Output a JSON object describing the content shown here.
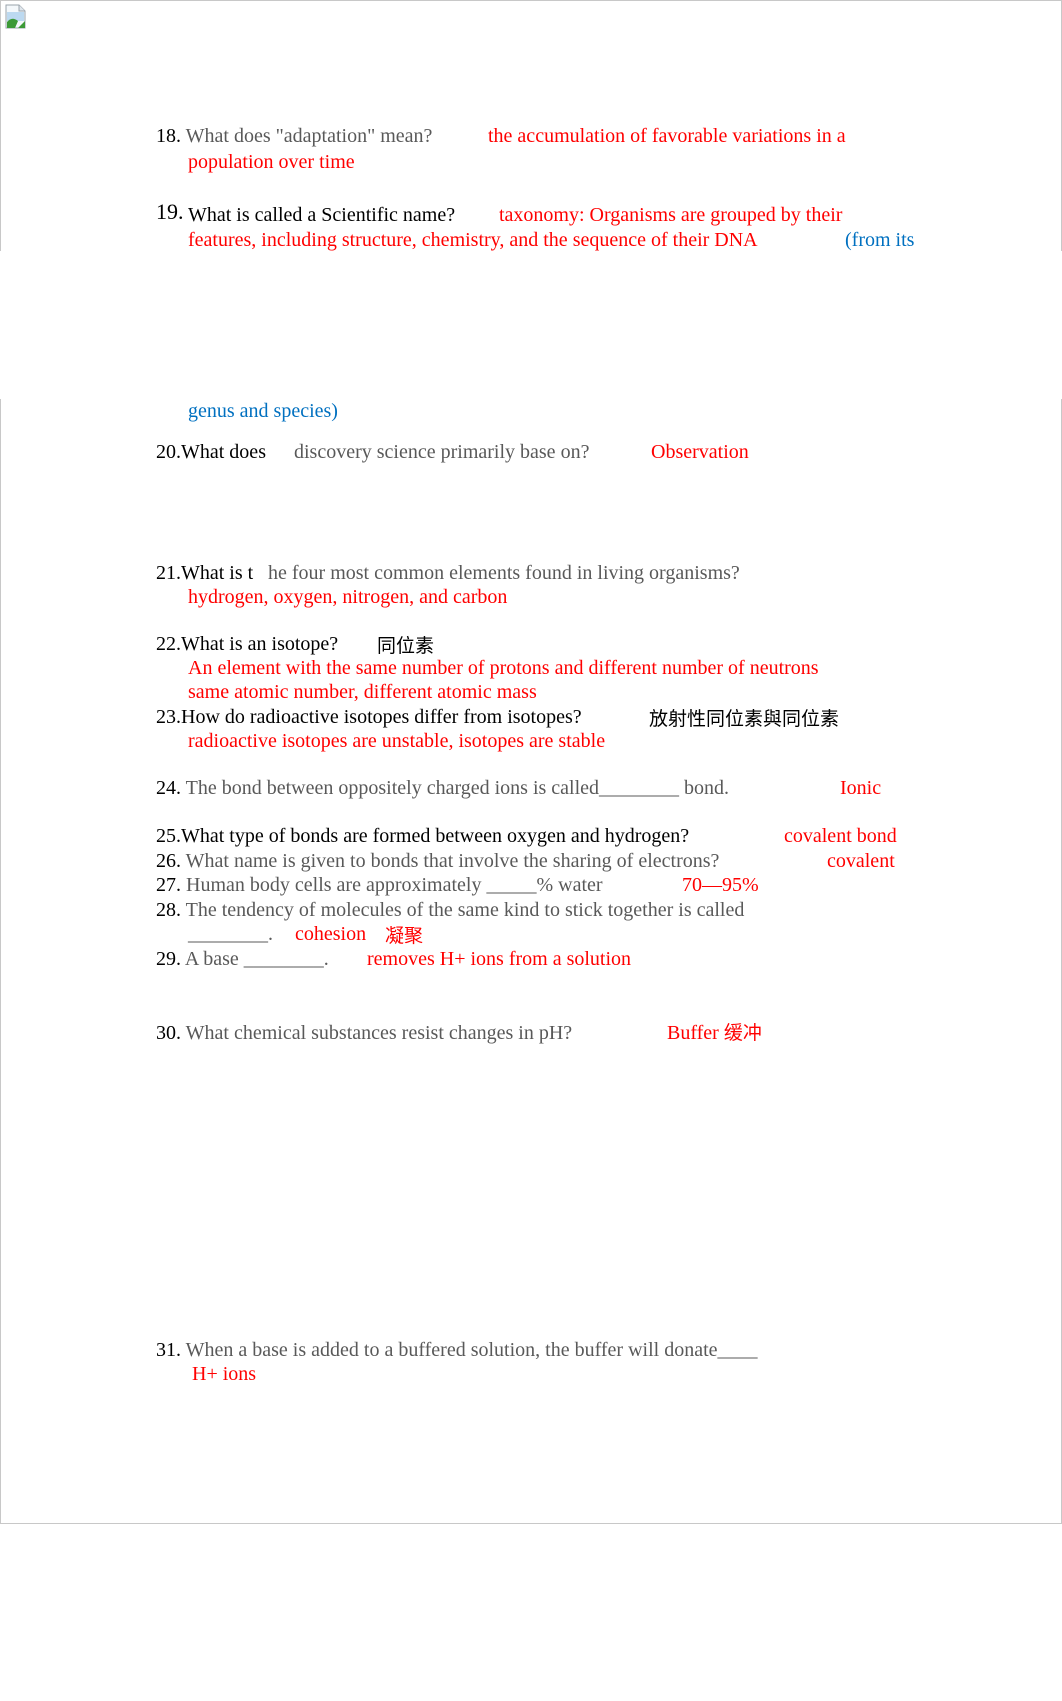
{
  "document": {
    "broken_image_icon": "broken-image-icon",
    "questions": [
      {
        "number": "18.",
        "question": "What does \"adaptation\" mean?",
        "answer_line1": "the accumulation of favorable variations in a",
        "answer_line2": "population over time"
      },
      {
        "number": "19.",
        "question": "What is called a Scientific name?",
        "answer_line1": "taxonomy: Organisms are grouped by their",
        "answer_line2": "features, including structure, chemistry, and the sequence of their DNA",
        "note_part1": "(from its",
        "note_part2": "genus and species)"
      },
      {
        "number": "20.",
        "question_part1": "What does",
        "question_part2": "discovery science primarily base on?",
        "answer": "Observation"
      },
      {
        "number": "21.",
        "question_part1": "What is t",
        "question_part2": "he four most common elements found in living organisms?",
        "answer": "hydrogen, oxygen, nitrogen, and carbon"
      },
      {
        "number": "22.",
        "question": "What is an isotope?",
        "translation": "同位素",
        "answer_line1": "An element with the same number of protons and different number of neutrons",
        "answer_line2": "same atomic number, different atomic mass"
      },
      {
        "number": "23.",
        "question": "How do radioactive isotopes differ from isotopes?",
        "translation": "放射性同位素與同位素",
        "answer": "radioactive isotopes are unstable, isotopes are stable"
      },
      {
        "number": "24.",
        "question": "The bond between oppositely charged ions is called________ bond.",
        "answer": "Ionic"
      },
      {
        "number": "25.",
        "question": "What type of bonds are formed between oxygen and hydrogen?",
        "answer": "covalent bond"
      },
      {
        "number": "26.",
        "question": "What name is given to bonds that involve the sharing of electrons?",
        "answer": "covalent"
      },
      {
        "number": "27.",
        "question": "Human body cells are approximately _____% water",
        "answer": "70—95%"
      },
      {
        "number": "28.",
        "question_line1": "The tendency of molecules of the same kind to stick together is called",
        "question_line2": "________.",
        "answer": "cohesion",
        "translation": "凝聚"
      },
      {
        "number": "29.",
        "question": "A base ________.",
        "answer": "removes H+ ions from a solution"
      },
      {
        "number": "30.",
        "question": "What chemical substances resist changes in pH?",
        "answer": "Buffer",
        "translation": "缓冲"
      },
      {
        "number": "31.",
        "question": "When a base is added to a buffered solution, the buffer will donate____",
        "answer": "H+ ions"
      }
    ]
  },
  "colors": {
    "answer": "#ff0000",
    "note": "#0070c0",
    "question_gray": "#595959",
    "frame_border": "#c8c8c8"
  }
}
